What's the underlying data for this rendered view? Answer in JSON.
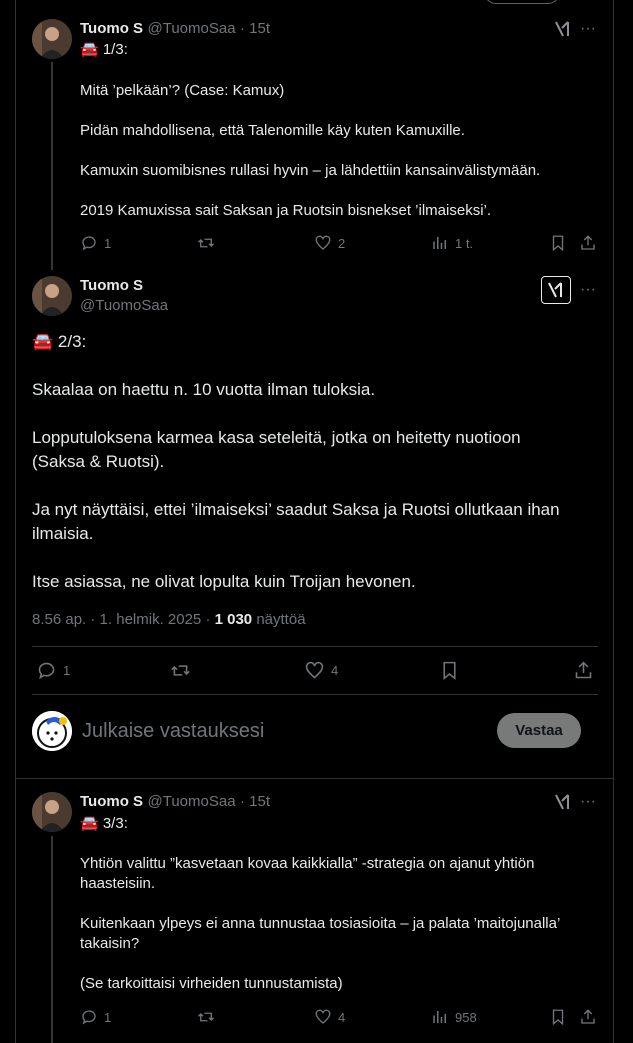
{
  "tweet1": {
    "name": "Tuomo S",
    "handle": "@TuomoSaa",
    "time": "· 15t",
    "lines": [
      "🚘 1/3:",
      "Mitä ’pelkään’? (Case: Kamux)",
      "Pidän mahdollisena, että Talenomille käy kuten Kamuxille.",
      "Kamuxin suomibisnes rullasi hyvin – ja lähdettiin kansainvälistymään.",
      "2019 Kamuxissa sait Saksan ja Ruotsin bisnekset ’ilmaiseksi’."
    ],
    "replies": "1",
    "likes": "2",
    "views": "1 t."
  },
  "tweet2": {
    "name": "Tuomo S",
    "handle": "@TuomoSaa",
    "paragraphs": [
      "🚘 2/3:",
      "Skaalaa on haettu n. 10 vuotta ilman tuloksia.",
      "Lopputuloksena karmea kasa seteleitä, jotka on heitetty nuotioon",
      "(Saksa & Ruotsi).",
      "Ja nyt näyttäisi, ettei ’ilmaiseksi’ saadut Saksa ja Ruotsi ollutkaan ihan",
      "ilmaisia.",
      "Itse asiassa, ne olivat lopulta kuin Troijan hevonen."
    ],
    "meta_time": "8.56 ap. · 1. helmik. 2025 ·",
    "meta_views": "1 030",
    "meta_views_label": "näyttöä",
    "replies": "1",
    "likes": "4"
  },
  "compose": {
    "placeholder": "Julkaise vastauksesi",
    "button": "Vastaa"
  },
  "tweet3": {
    "name": "Tuomo S",
    "handle": "@TuomoSaa",
    "time": "· 15t",
    "lines": [
      "🚘 3/3:",
      "Yhtiön valittu ”kasvetaan kovaa kaikkialla” -strategia on ajanut yhtiön",
      "haasteisiin.",
      "Kuitenkaan ylpeys ei anna tunnustaa tosiasioita – ja palata ’maitojunalla’",
      "takaisin?",
      "(Se tarkoittaisi virheiden tunnustamista)"
    ],
    "replies": "1",
    "likes": "4",
    "views": "958"
  },
  "icons": [
    "grok-icon",
    "more-icon",
    "reply-icon",
    "retweet-icon",
    "like-icon",
    "views-icon",
    "bookmark-icon",
    "share-icon"
  ],
  "colors": {
    "background": "#000000",
    "text": "#e7e9ea",
    "muted": "#71767b",
    "border": "#2f3336",
    "button": "#787a7a"
  }
}
